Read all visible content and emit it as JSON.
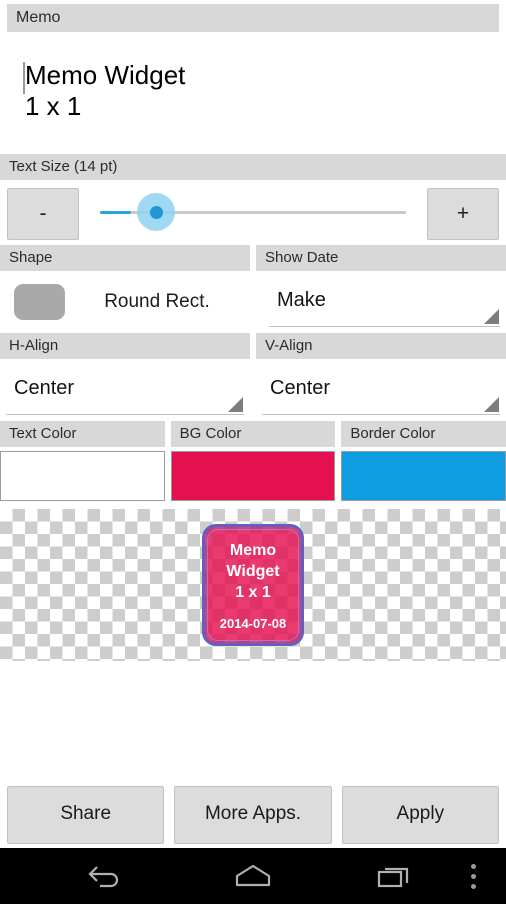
{
  "memo_section": {
    "label": "Memo",
    "text": "Memo Widget\n1 x 1",
    "placeholder": "Memo"
  },
  "text_size": {
    "label": "Text Size (14 pt)",
    "value_pt": 14,
    "decrease_label": "-",
    "increase_label": "+",
    "slider_percent": 10
  },
  "shape": {
    "label": "Shape",
    "value": "Round Rect.",
    "swatch_color": "#a9a9a9"
  },
  "show_date": {
    "label": "Show Date",
    "value": "Make"
  },
  "h_align": {
    "label": "H-Align",
    "value": "Center"
  },
  "v_align": {
    "label": "V-Align",
    "value": "Center"
  },
  "colors": {
    "text_color": {
      "label": "Text Color",
      "value": "#ffffff"
    },
    "bg_color": {
      "label": "BG Color",
      "value": "#e4104f"
    },
    "border_color": {
      "label": "Border Color",
      "value": "#0d9de0"
    }
  },
  "preview": {
    "text": "Memo\nWidget\n1 x 1",
    "date": "2014-07-08",
    "border_color": "#5b62c4",
    "bg_color": "#e4104f"
  },
  "buttons": {
    "share": "Share",
    "more_apps": "More Apps.",
    "apply": "Apply"
  },
  "navbar": {
    "back": "back-icon",
    "home": "home-icon",
    "recents": "recents-icon",
    "overflow": "overflow-menu-icon"
  }
}
